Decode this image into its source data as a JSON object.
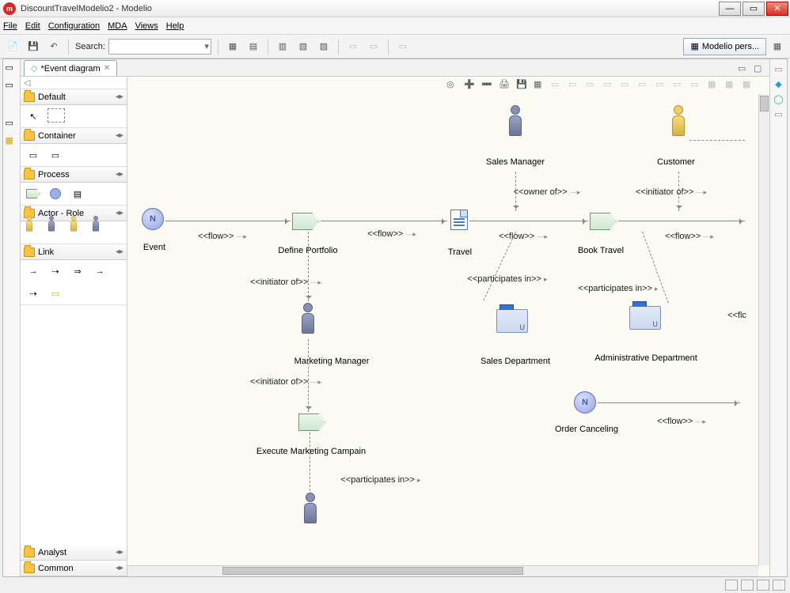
{
  "window": {
    "title": "DiscountTravelModelio2 - Modelio"
  },
  "menu": {
    "file": "File",
    "edit": "Edit",
    "configuration": "Configuration",
    "mda": "MDA",
    "views": "Views",
    "help": "Help"
  },
  "toolbar": {
    "search_label": "Search:",
    "perspective": "Modelio pers..."
  },
  "tab": {
    "event_diagram": "*Event diagram"
  },
  "palette": {
    "default": "Default",
    "container": "Container",
    "process": "Process",
    "actor_role": "Actor - Role",
    "link": "Link",
    "analyst": "Analyst",
    "common": "Common"
  },
  "diagram": {
    "sales_manager": "Sales Manager",
    "customer": "Customer",
    "event": "Event",
    "define_portfolio": "Define Portfolio",
    "travel": "Travel",
    "book_travel": "Book Travel",
    "marketing_manager": "Marketing Manager",
    "execute_campaign": "Execute Marketing Campain",
    "sales_department": "Sales Department",
    "admin_department": "Administrative Department",
    "order_canceling": "Order Canceling",
    "flow": "<<flow>>",
    "owner_of": "<<owner of>>",
    "initiator_of": "<<initiator of>>",
    "participates_in": "<<participates in>>",
    "flc": "<<flc"
  }
}
